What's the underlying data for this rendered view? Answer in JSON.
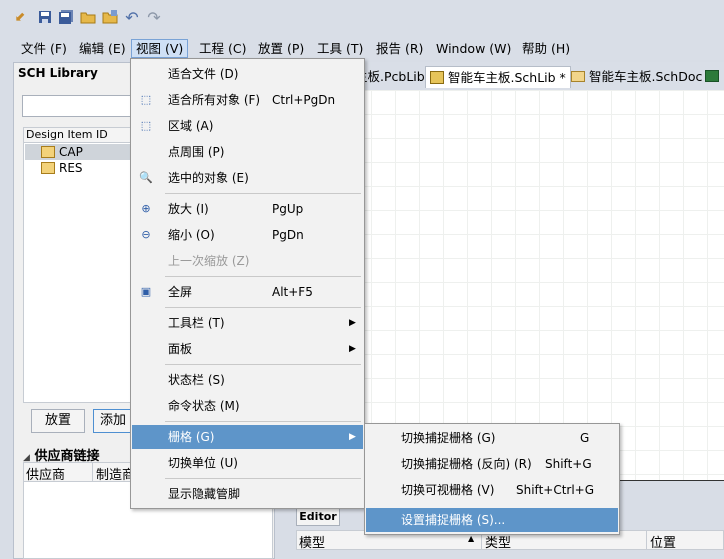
{
  "menubar": {
    "items": [
      {
        "label": "文件 (F)"
      },
      {
        "label": "编辑 (E)"
      },
      {
        "label": "视图 (V)"
      },
      {
        "label": "工程 (C)"
      },
      {
        "label": "放置 (P)"
      },
      {
        "label": "工具 (T)"
      },
      {
        "label": "报告 (R)"
      },
      {
        "label": "Window (W)"
      },
      {
        "label": "帮助 (H)"
      }
    ]
  },
  "sch_panel": {
    "title": "SCH Library",
    "column_header": "Design Item ID",
    "items": [
      "CAP",
      "RES"
    ],
    "place_button": "放置",
    "add_button": "添加",
    "supplier_section": "供应商链接",
    "supplier_col1": "供应商",
    "supplier_col2": "制造商"
  },
  "doc_tabs": {
    "items": [
      {
        "label": "主板.PcbLib"
      },
      {
        "label": "智能车主板.SchLib *"
      },
      {
        "label": "智能车主板.SchDoc"
      }
    ]
  },
  "editor": {
    "tab": "Editor",
    "col_model": "模型",
    "col_type": "类型",
    "col_location": "位置"
  },
  "view_menu": {
    "items": [
      {
        "label": "适合文件 (D)",
        "shortcut": ""
      },
      {
        "label": "适合所有对象 (F)",
        "shortcut": "Ctrl+PgDn"
      },
      {
        "label": "区域 (A)",
        "shortcut": ""
      },
      {
        "label": "点周围 (P)",
        "shortcut": ""
      },
      {
        "label": "选中的对象 (E)",
        "shortcut": ""
      },
      {
        "label": "放大 (I)",
        "shortcut": "PgUp"
      },
      {
        "label": "缩小 (O)",
        "shortcut": "PgDn"
      },
      {
        "label": "上一次缩放 (Z)",
        "shortcut": ""
      },
      {
        "label": "全屏",
        "shortcut": "Alt+F5"
      },
      {
        "label": "工具栏 (T)",
        "shortcut": ""
      },
      {
        "label": "面板",
        "shortcut": ""
      },
      {
        "label": "状态栏 (S)",
        "shortcut": ""
      },
      {
        "label": "命令状态 (M)",
        "shortcut": ""
      },
      {
        "label": "栅格 (G)",
        "shortcut": ""
      },
      {
        "label": "切换单位 (U)",
        "shortcut": ""
      },
      {
        "label": "显示隐藏管脚",
        "shortcut": ""
      }
    ]
  },
  "grid_submenu": {
    "items": [
      {
        "label": "切换捕捉栅格 (G)",
        "shortcut": "G"
      },
      {
        "label": "切换捕捉栅格 (反向) (R)",
        "shortcut": "Shift+G"
      },
      {
        "label": "切换可视栅格 (V)",
        "shortcut": "Shift+Ctrl+G"
      },
      {
        "label": "设置捕捉栅格 (S)...",
        "shortcut": ""
      }
    ]
  },
  "icons": {
    "quick": [
      "app-logo-icon",
      "save-icon",
      "save-all-icon",
      "open-icon",
      "open-project-icon",
      "undo-icon",
      "redo-icon"
    ],
    "accent": "#5e95c9"
  }
}
